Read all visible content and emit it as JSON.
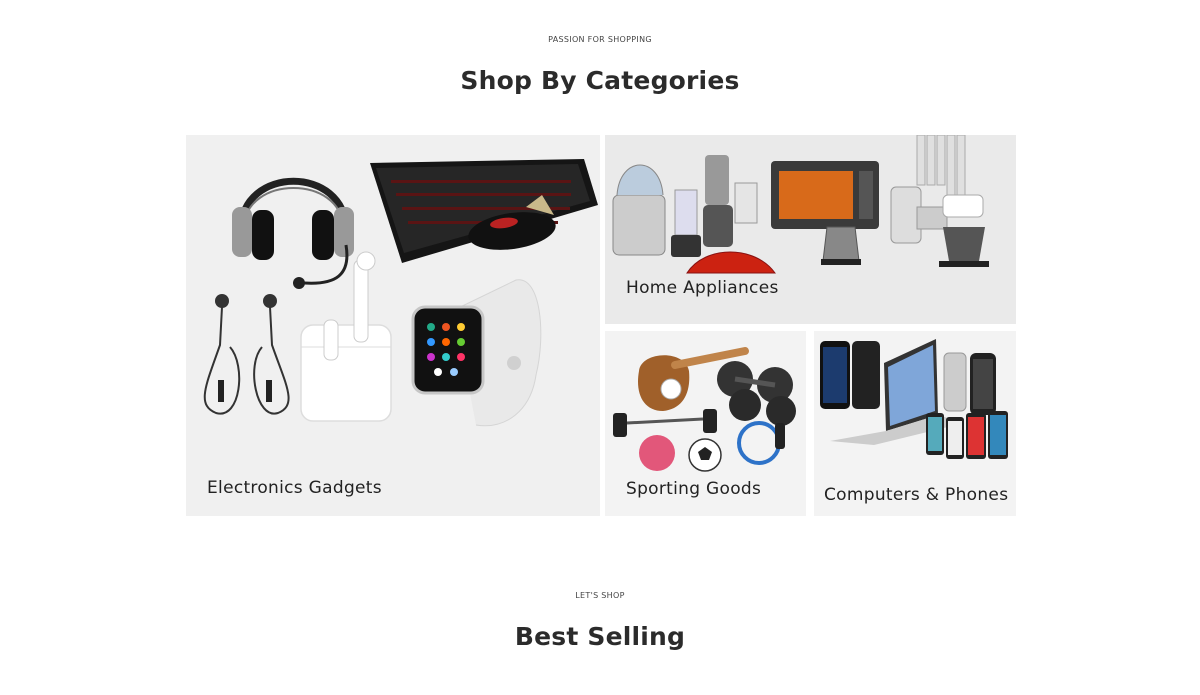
{
  "categories_section": {
    "eyebrow": "PASSION FOR SHOPPING",
    "title": "Shop By Categories",
    "tiles": [
      {
        "label": "Electronics Gadgets",
        "icon": "electronics-gadgets-icon"
      },
      {
        "label": "Home Appliances",
        "icon": "home-appliances-icon"
      },
      {
        "label": "Sporting Goods",
        "icon": "sporting-goods-icon"
      },
      {
        "label": "Computers & Phones",
        "icon": "computers-phones-icon"
      }
    ]
  },
  "best_selling_section": {
    "eyebrow": "LET'S SHOP",
    "title": "Best Selling"
  }
}
